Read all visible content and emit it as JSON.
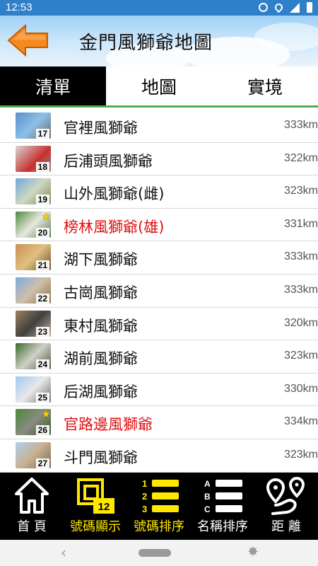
{
  "status": {
    "time": "12:53",
    "icons": [
      "alarm-icon",
      "location-icon",
      "signal-icon",
      "battery-icon"
    ]
  },
  "header": {
    "title": "金門風獅爺地圖",
    "back_icon": "back-arrow-icon"
  },
  "tabs": [
    {
      "label": "清單",
      "active": true
    },
    {
      "label": "地圖",
      "active": false
    },
    {
      "label": "實境",
      "active": false
    }
  ],
  "items": [
    {
      "num": "17",
      "name": "官裡風獅爺",
      "distance": "333km",
      "star": false,
      "highlight": false
    },
    {
      "num": "18",
      "name": "后浦頭風獅爺",
      "distance": "322km",
      "star": false,
      "highlight": false
    },
    {
      "num": "19",
      "name": "山外風獅爺(雌)",
      "distance": "323km",
      "star": false,
      "highlight": false
    },
    {
      "num": "20",
      "name": "榜林風獅爺(雄)",
      "distance": "331km",
      "star": true,
      "highlight": true
    },
    {
      "num": "21",
      "name": "湖下風獅爺",
      "distance": "333km",
      "star": false,
      "highlight": false
    },
    {
      "num": "22",
      "name": "古崗風獅爺",
      "distance": "333km",
      "star": false,
      "highlight": false
    },
    {
      "num": "23",
      "name": "東村風獅爺",
      "distance": "320km",
      "star": false,
      "highlight": false
    },
    {
      "num": "24",
      "name": "湖前風獅爺",
      "distance": "323km",
      "star": false,
      "highlight": false
    },
    {
      "num": "25",
      "name": "后湖風獅爺",
      "distance": "330km",
      "star": false,
      "highlight": false
    },
    {
      "num": "26",
      "name": "官路邊風獅爺",
      "distance": "334km",
      "star": true,
      "highlight": true
    },
    {
      "num": "27",
      "name": "斗門風獅爺",
      "distance": "323km",
      "star": false,
      "highlight": false
    }
  ],
  "toolbar": {
    "home": {
      "label": "首 頁",
      "icon": "home-icon"
    },
    "number_display": {
      "label": "號碼顯示",
      "badge": "12",
      "icon": "number-display-icon"
    },
    "number_sort": {
      "label": "號碼排序",
      "icon": "number-sort-icon",
      "digits": [
        "1",
        "2",
        "3"
      ]
    },
    "name_sort": {
      "label": "名稱排序",
      "icon": "name-sort-icon",
      "letters": [
        "A",
        "B",
        "C"
      ]
    },
    "distance": {
      "label": "距 離",
      "icon": "route-distance-icon"
    }
  },
  "colors": {
    "accent_yellow": "#ffe800",
    "highlight_red": "#e01010",
    "tab_underline": "#4caf50",
    "status_bar": "#2f7fc9"
  }
}
